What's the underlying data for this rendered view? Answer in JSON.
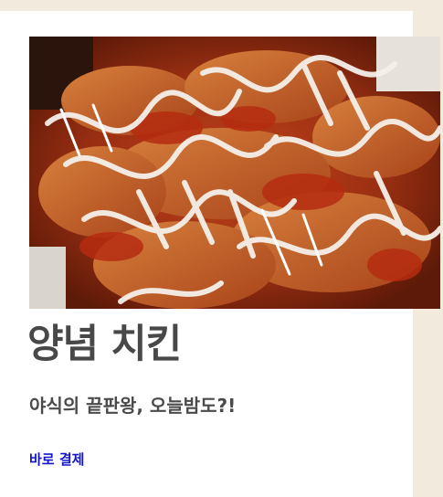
{
  "product": {
    "title": "양념 치킨",
    "subtitle": "야식의 끝판왕, 오늘밤도?!",
    "buy_label": "바로 결제"
  },
  "colors": {
    "page_background": "#f2eadd",
    "card_background": "#ffffff",
    "title_text": "#484848",
    "link": "#1515c8"
  }
}
